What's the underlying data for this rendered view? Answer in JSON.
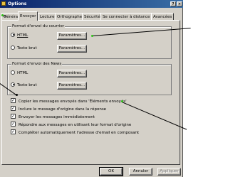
{
  "window": {
    "title": "Options",
    "help_button": "?",
    "close_button": "×"
  },
  "tabs": [
    "Général",
    "Envoyer",
    "Lecture",
    "Orthographe",
    "Sécurité",
    "Se connecter à distance",
    "Avancées"
  ],
  "active_tab": "Envoyer",
  "mail_group": {
    "title": "Format d'envoi du courrier",
    "html": "HTML",
    "text": "Texte brut",
    "selected": "HTML",
    "settings1": "Paramètres...",
    "settings2": "Paramètres..."
  },
  "news_group": {
    "title": "Format d'envoi des News",
    "html": "HTML",
    "text": "Texte brut",
    "selected": "Texte brut",
    "settings1": "Paramètres...",
    "settings2": "Paramètres..."
  },
  "options": [
    {
      "label": "Copier les messages envoyés dans 'Éléments envoyés'",
      "checked": true
    },
    {
      "label": "Inclure le message d'origine dans la réponse",
      "checked": true
    },
    {
      "label": "Envoyer les messages immédiatement",
      "checked": true
    },
    {
      "label": "Répondre aux messages en utilisant leur format d'origine",
      "checked": true
    },
    {
      "label": "Compléter automatiquement l'adresse d'email en composant",
      "checked": true
    }
  ],
  "footer": {
    "ok": "OK",
    "cancel": "Annuler",
    "apply": "Appliquer"
  },
  "colors": {
    "dialog_bg": "#d4d0c8",
    "titlebar_start": "#0a246a",
    "callout_dot": "#2ec21a"
  }
}
